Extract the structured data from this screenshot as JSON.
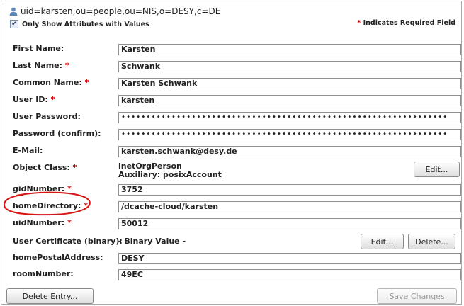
{
  "header": {
    "dn": "uid=karsten,ou=people,ou=NIS,o=DESY,c=DE",
    "icon": "person-icon",
    "only_show_label": "Only Show Attributes with Values",
    "only_show_checked": true,
    "required_note": "Indicates Required Field",
    "required_marker": "*"
  },
  "attributes": [
    {
      "label": "First Name:",
      "required": false,
      "value": "Karsten"
    },
    {
      "label": "Last Name:",
      "required": true,
      "value": "Schwank"
    },
    {
      "label": "Common Name:",
      "required": true,
      "value": "Karsten Schwank"
    },
    {
      "label": "User ID:",
      "required": true,
      "value": "karsten"
    },
    {
      "label": "User Password:",
      "required": false,
      "value": "•••••••••••••••••••••••••••••••••••••••••••••••••••••••••••••••••"
    },
    {
      "label": "Password (confirm):",
      "required": false,
      "value": "•••••••••••••••••••••••••••••••••••••••••••••••••••••••••••••••••"
    },
    {
      "label": "E-Mail:",
      "required": false,
      "value": "karsten.schwank@desy.de"
    },
    {
      "label": "Object Class:",
      "required": true,
      "value_line1": "inetOrgPerson",
      "value_line2": "Auxiliary: posixAccount",
      "button": "Edit..."
    },
    {
      "label": "gidNumber:",
      "required": true,
      "value": "3752"
    },
    {
      "label": "homeDirectory:",
      "required": true,
      "value": "/dcache-cloud/karsten"
    },
    {
      "label": "uidNumber:",
      "required": true,
      "value": "50012"
    },
    {
      "label": "User Certificate (binary):",
      "required": false,
      "value": "- Binary Value -",
      "edit_button": "Edit...",
      "delete_button": "Delete..."
    },
    {
      "label": "homePostalAddress:",
      "required": false,
      "value": "DESY"
    },
    {
      "label": "roomNumber:",
      "required": false,
      "value": "49EC"
    }
  ],
  "footer": {
    "delete_entry": "Delete Entry...",
    "save_changes": "Save Changes"
  }
}
